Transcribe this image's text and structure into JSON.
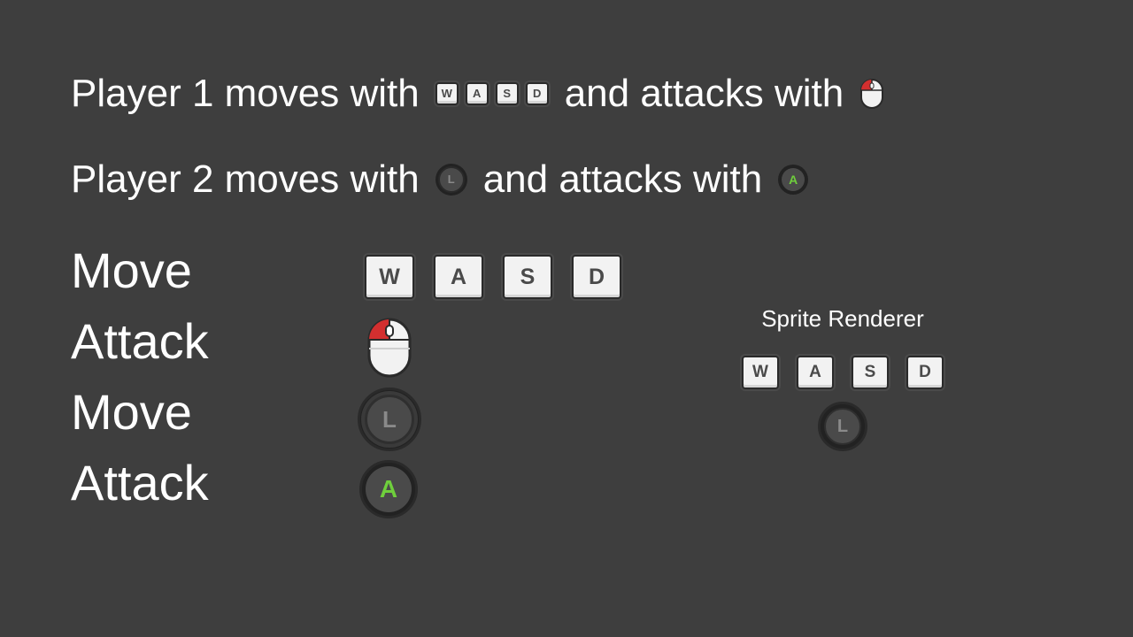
{
  "instructions": {
    "player1": {
      "prefix": "Player 1 moves with",
      "keys": [
        "W",
        "A",
        "S",
        "D"
      ],
      "middle": "and attacks with",
      "attack_icon": "mouse-left-click-icon"
    },
    "player2": {
      "prefix": "Player 2 moves with",
      "move_icon": "left-stick-icon",
      "move_glyph": "L",
      "middle": "and attacks with",
      "attack_icon": "a-button-icon",
      "attack_glyph": "A"
    }
  },
  "rows": [
    {
      "label": "Move",
      "type": "keys",
      "keys": [
        "W",
        "A",
        "S",
        "D"
      ]
    },
    {
      "label": "Attack",
      "type": "mouse",
      "icon": "mouse-left-click-icon"
    },
    {
      "label": "Move",
      "type": "stick",
      "glyph": "L",
      "icon": "left-stick-icon"
    },
    {
      "label": "Attack",
      "type": "button",
      "glyph": "A",
      "icon": "a-button-icon"
    }
  ],
  "sprite_renderer": {
    "title": "Sprite Renderer",
    "keys": [
      "W",
      "A",
      "S",
      "D"
    ],
    "stick_glyph": "L"
  },
  "colors": {
    "background": "#3e3e3e",
    "text": "#ffffff",
    "key_face": "#f2f2f2",
    "mouse_click": "#d32f2f",
    "a_button": "#6fcf3c"
  }
}
